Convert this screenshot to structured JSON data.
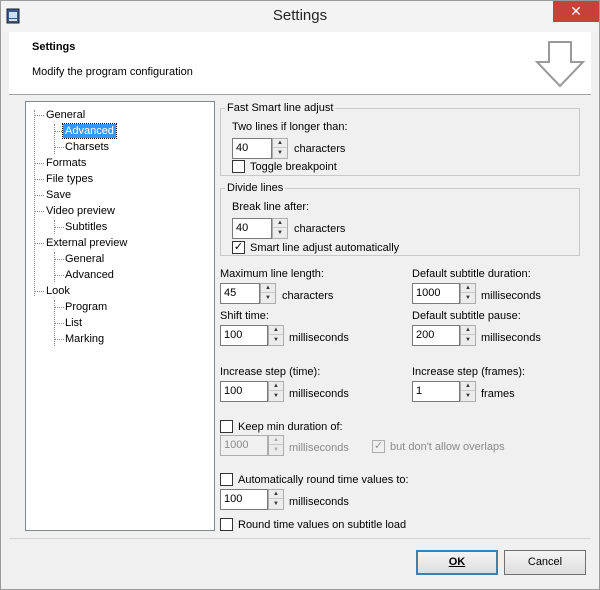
{
  "window": {
    "title": "Settings",
    "close_glyph": "✕"
  },
  "header": {
    "title": "Settings",
    "subtitle": "Modify the program configuration",
    "icon": "down-arrow-icon"
  },
  "tree": {
    "items": [
      {
        "label": "General",
        "level": 0
      },
      {
        "label": "Advanced",
        "level": 1,
        "selected": true
      },
      {
        "label": "Charsets",
        "level": 1
      },
      {
        "label": "Formats",
        "level": 0
      },
      {
        "label": "File types",
        "level": 0
      },
      {
        "label": "Save",
        "level": 0
      },
      {
        "label": "Video preview",
        "level": 0
      },
      {
        "label": "Subtitles",
        "level": 1
      },
      {
        "label": "External preview",
        "level": 0
      },
      {
        "label": "General",
        "level": 1
      },
      {
        "label": "Advanced",
        "level": 1
      },
      {
        "label": "Look",
        "level": 0
      },
      {
        "label": "Program",
        "level": 1
      },
      {
        "label": "List",
        "level": 1
      },
      {
        "label": "Marking",
        "level": 1
      }
    ]
  },
  "fast_smart": {
    "legend": "Fast Smart line adjust",
    "two_lines_label": "Two lines if longer than:",
    "two_lines_value": "40",
    "unit": "characters",
    "toggle_breakpoint_label": "Toggle breakpoint",
    "toggle_breakpoint_checked": false
  },
  "divide_lines": {
    "legend": "Divide lines",
    "break_after_label": "Break line after:",
    "break_after_value": "40",
    "unit": "characters",
    "smart_adjust_label": "Smart line adjust automatically",
    "smart_adjust_checked": true
  },
  "fields": {
    "max_line_label": "Maximum line length:",
    "max_line_value": "45",
    "max_line_unit": "characters",
    "default_duration_label": "Default subtitle duration:",
    "default_duration_value": "1000",
    "default_duration_unit": "milliseconds",
    "shift_time_label": "Shift time:",
    "shift_time_value": "100",
    "shift_time_unit": "milliseconds",
    "default_pause_label": "Default subtitle pause:",
    "default_pause_value": "200",
    "default_pause_unit": "milliseconds",
    "inc_time_label": "Increase step (time):",
    "inc_time_value": "100",
    "inc_time_unit": "milliseconds",
    "inc_frames_label": "Increase step (frames):",
    "inc_frames_value": "1",
    "inc_frames_unit": "frames"
  },
  "keep_min": {
    "label": "Keep min duration of:",
    "checked": false,
    "value": "1000",
    "unit": "milliseconds",
    "overlap_label": "but don't allow overlaps",
    "overlap_checked": true
  },
  "auto_round": {
    "label": "Automatically round time values to:",
    "checked": false,
    "value": "100",
    "unit": "milliseconds"
  },
  "round_on_load": {
    "label": "Round time values on subtitle load",
    "checked": false
  },
  "buttons": {
    "ok_label": "OK",
    "cancel_label": "Cancel"
  },
  "spin": {
    "up_glyph": "▲",
    "down_glyph": "▼",
    "check_glyph": "✓"
  }
}
